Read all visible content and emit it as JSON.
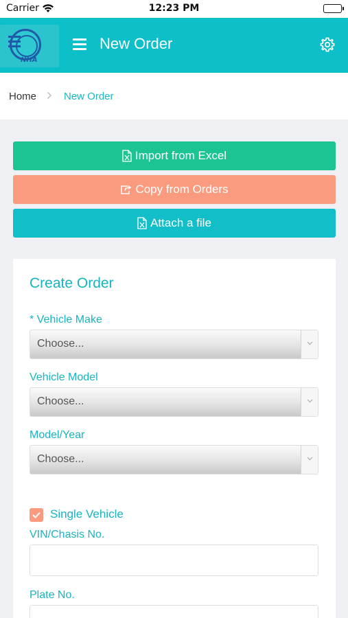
{
  "status_bar": {
    "carrier": "Carrier",
    "time": "12:23 PM"
  },
  "header": {
    "title": "New Order",
    "logo_text": "NHA"
  },
  "breadcrumb": {
    "home": "Home",
    "separator": ">",
    "current": "New Order"
  },
  "actions": {
    "import_label": "Import from Excel",
    "copy_label": "Copy from Orders",
    "attach_label": "Attach a file"
  },
  "form": {
    "title": "Create Order",
    "vehicle_make": {
      "label": "* Vehicle Make",
      "value": "Choose..."
    },
    "vehicle_model": {
      "label": "Vehicle Model",
      "value": "Choose..."
    },
    "model_year": {
      "label": "Model/Year",
      "value": "Choose..."
    },
    "single_vehicle": {
      "label": "Single Vehicle",
      "checked": true
    },
    "vin": {
      "label": "VIN/Chasis No.",
      "value": ""
    },
    "plate": {
      "label": "Plate No.",
      "value": ""
    }
  },
  "colors": {
    "primary": "#0cbfc8",
    "import_button": "#1cc493",
    "copy_button": "#fa9a7e",
    "attach_button": "#12bfc8",
    "label_teal": "#17b4c1"
  },
  "icons": [
    "wifi-icon",
    "battery-icon",
    "menu-icon",
    "gear-icon",
    "chevron-right-icon",
    "excel-icon",
    "share-icon",
    "dropdown-arrow-icon",
    "checkmark-icon"
  ]
}
